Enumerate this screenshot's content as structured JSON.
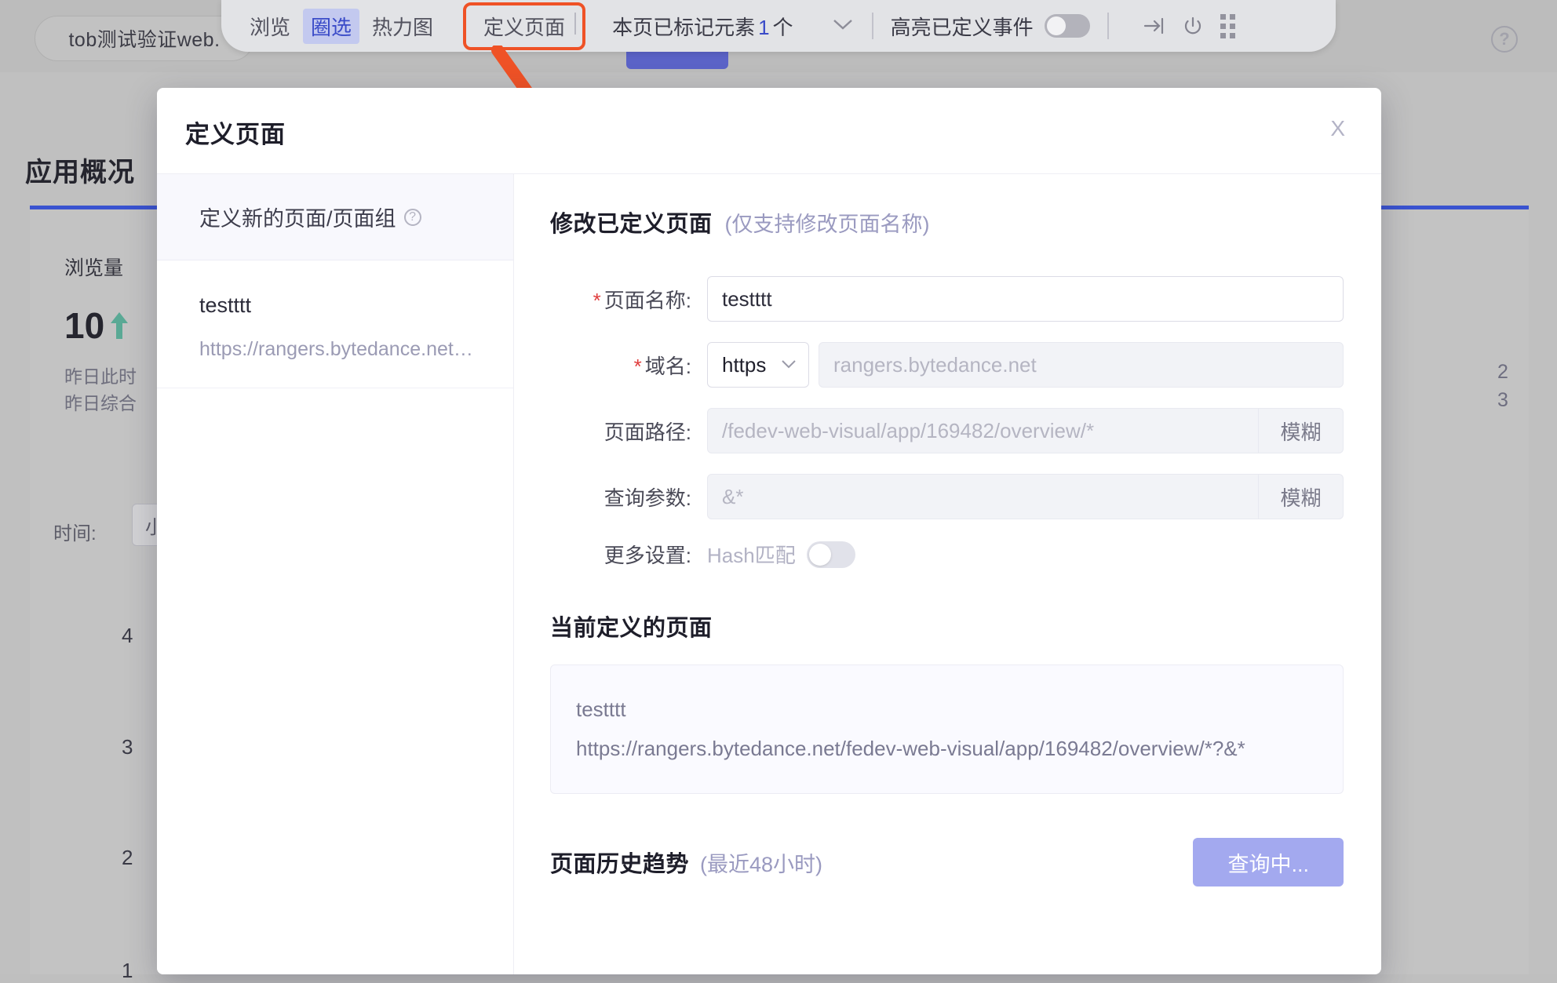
{
  "background": {
    "app_pill": "tob测试验证web.",
    "help_icon": "question-circle-icon",
    "page_title": "应用概况",
    "metric_label": "浏览量",
    "metric_value": "10",
    "metric_sub1": "昨日此时",
    "metric_sub2": "昨日综合",
    "time_label": "时间:",
    "time_value": "小",
    "y_ticks": [
      "4",
      "3",
      "2",
      "1"
    ],
    "right_numbers": [
      "2",
      "3"
    ]
  },
  "toolbar": {
    "items": [
      {
        "label": "浏览",
        "active": false
      },
      {
        "label": "圈选",
        "active": true
      },
      {
        "label": "热力图",
        "active": false
      }
    ],
    "define_page": "定义页面",
    "marked_prefix": "本页已标记元素",
    "marked_count": "1",
    "marked_suffix": "个",
    "caret_icon": "chevron-down-icon",
    "highlight_label": "高亮已定义事件",
    "highlight_toggle": "off",
    "icons": [
      "exit-arrow-icon",
      "power-icon",
      "drag-handle-icon"
    ]
  },
  "modal": {
    "title": "定义页面",
    "close_label": "X",
    "sidebar": {
      "new_page_label": "定义新的页面/页面组",
      "new_page_help_icon": "question-circle-icon",
      "items": [
        {
          "name": "testttt",
          "url": "https://rangers.bytedance.net…"
        }
      ]
    },
    "main": {
      "heading": "修改已定义页面",
      "heading_note": "(仅支持修改页面名称)",
      "fields": [
        {
          "label": "页面名称:",
          "required": true,
          "value": "testttt",
          "disabled": false
        },
        {
          "label": "域名:",
          "required": true,
          "select_value": "https",
          "placeholder": "rangers.bytedance.net",
          "disabled": true
        },
        {
          "label": "页面路径:",
          "required": false,
          "placeholder": "/fedev-web-visual/app/169482/overview/*",
          "suffix": "模糊",
          "disabled": true
        },
        {
          "label": "查询参数:",
          "required": false,
          "placeholder": "&*",
          "suffix": "模糊",
          "disabled": true
        }
      ],
      "more_settings_label": "更多设置:",
      "hash_match_label": "Hash匹配",
      "hash_match_toggle": "off",
      "current_page_title": "当前定义的页面",
      "current_page_name": "testttt",
      "current_page_url": "https://rangers.bytedance.net/fedev-web-visual/app/169482/overview/*?&*",
      "trend_title": "页面历史趋势",
      "trend_note": "(最近48小时)",
      "query_button": "查询中..."
    }
  },
  "colors": {
    "accent_blue": "#3a4bc8",
    "arrow_orange": "#ef5226",
    "button_purple": "#a3a9ef",
    "required_red": "#e03e3e"
  }
}
